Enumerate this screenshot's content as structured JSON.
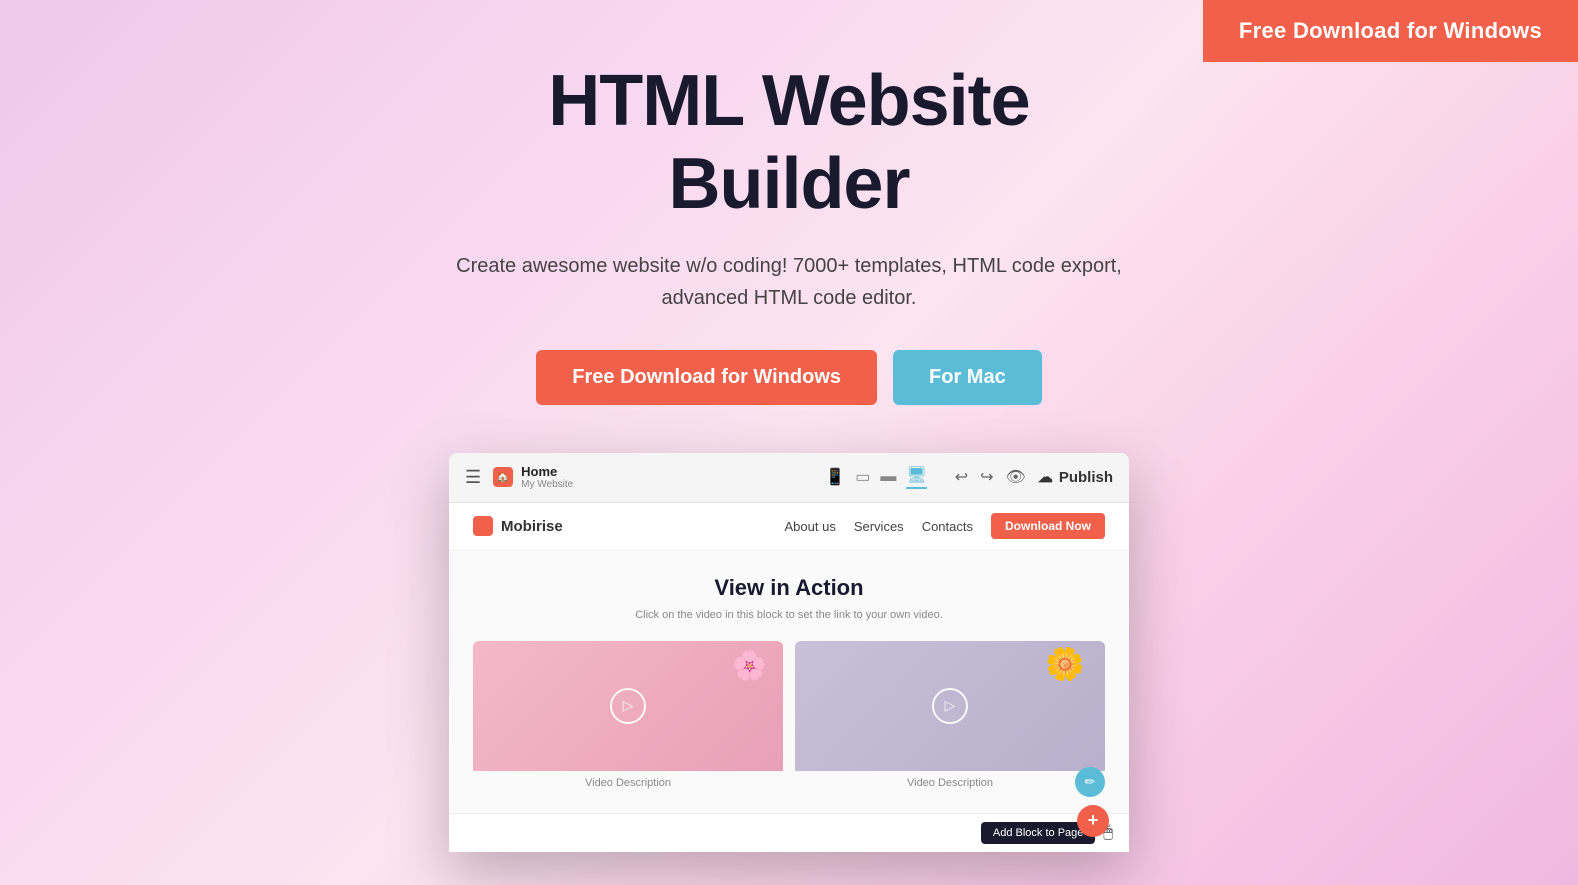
{
  "topbar": {
    "download_label": "Free Download for Windows"
  },
  "hero": {
    "title_line1": "HTML Website",
    "title_line2": "Builder",
    "subtitle": "Create awesome website w/o coding! 7000+ templates, HTML code export, advanced HTML code editor.",
    "btn_windows": "Free Download for Windows",
    "btn_mac": "For Mac"
  },
  "app": {
    "toolbar": {
      "home_title": "Home",
      "home_sub": "My Website",
      "devices": [
        "mobile",
        "tablet",
        "laptop",
        "desktop"
      ],
      "active_device": "desktop",
      "publish_label": "Publish"
    },
    "inner_nav": {
      "logo_text": "Mobirise",
      "links": [
        "About us",
        "Services",
        "Contacts"
      ],
      "cta_label": "Download Now"
    },
    "content": {
      "heading": "View in Action",
      "subtext": "Click on the video in this block to set the link to your own video.",
      "videos": [
        {
          "desc": "Video Description",
          "theme": "pink"
        },
        {
          "desc": "Video Description",
          "theme": "purple"
        }
      ]
    },
    "add_block_label": "Add Block to Page",
    "cursor_label": "cursor"
  }
}
